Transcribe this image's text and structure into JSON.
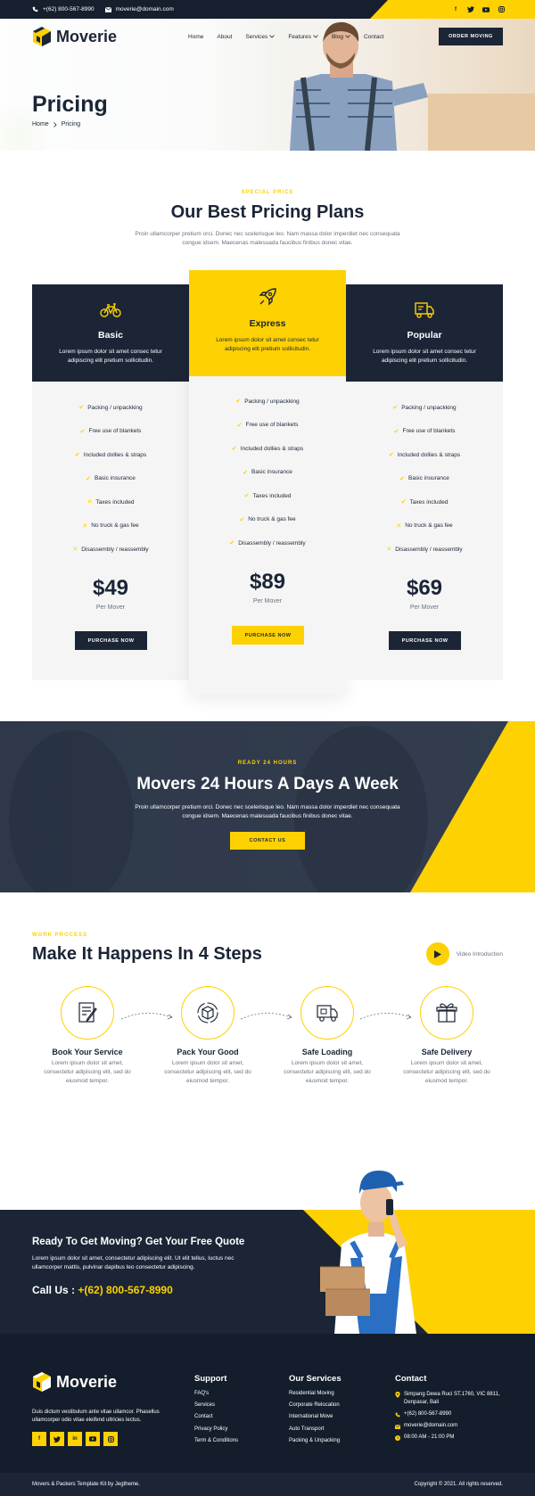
{
  "topbar": {
    "phone": "+(62) 800-567-8990",
    "email": "moverie@domain.com",
    "socials": [
      "facebook-icon",
      "twitter-icon",
      "youtube-icon",
      "instagram-icon"
    ]
  },
  "nav": {
    "brand": "Moverie",
    "items": [
      {
        "label": "Home",
        "dropdown": false
      },
      {
        "label": "About",
        "dropdown": false
      },
      {
        "label": "Services",
        "dropdown": true
      },
      {
        "label": "Features",
        "dropdown": true
      },
      {
        "label": "Blog",
        "dropdown": true
      },
      {
        "label": "Contact",
        "dropdown": false
      }
    ],
    "cta": "ORDER MOVING"
  },
  "hero": {
    "title": "Pricing",
    "breadcrumb": [
      "Home",
      "Pricing"
    ]
  },
  "pricing": {
    "eyebrow": "SPECIAL PRICE",
    "title": "Our Best Pricing Plans",
    "desc": "Proin ullamcorper pretium orci. Donec nec scelerisque leo. Nam massa dolor imperdiet nec consequata congue idsem. Maecenas malesuada faucibus finibus donec vitae.",
    "plans": [
      {
        "name": "Basic",
        "icon": "bicycle-icon",
        "desc": "Lorem ipsum dolor sit amet consec tetur adipiscing elit pretium sollicitudin.",
        "features": [
          {
            "label": "Packing / unpackking",
            "included": true
          },
          {
            "label": "Free use of blankets",
            "included": true
          },
          {
            "label": "Included dollies & straps",
            "included": true
          },
          {
            "label": "Basic insurance",
            "included": true
          },
          {
            "label": "Taxes included",
            "included": false
          },
          {
            "label": "No truck & gas fee",
            "included": false
          },
          {
            "label": "Disassembly / reassembly",
            "included": false
          }
        ],
        "price": "$49",
        "per": "Per Mover",
        "button": "PURCHASE NOW"
      },
      {
        "name": "Express",
        "icon": "rocket-icon",
        "desc": "Lorem ipsum dolor sit amet consec tetur adipiscing elit pretium sollicitudin.",
        "features": [
          {
            "label": "Packing / unpackking",
            "included": true
          },
          {
            "label": "Free use of blankets",
            "included": true
          },
          {
            "label": "Included dollies & straps",
            "included": true
          },
          {
            "label": "Basic insurance",
            "included": true
          },
          {
            "label": "Taxes included",
            "included": true
          },
          {
            "label": "No truck & gas fee",
            "included": true
          },
          {
            "label": "Disassembly / reassembly",
            "included": true
          }
        ],
        "price": "$89",
        "per": "Per Mover",
        "button": "PURCHASE NOW"
      },
      {
        "name": "Popular",
        "icon": "truck-icon",
        "desc": "Lorem ipsum dolor sit amet consec tetur adipiscing elit pretium sollicitudin.",
        "features": [
          {
            "label": "Packing / unpackking",
            "included": true
          },
          {
            "label": "Free use of blankets",
            "included": true
          },
          {
            "label": "Included dollies & straps",
            "included": true
          },
          {
            "label": "Basic insurance",
            "included": true
          },
          {
            "label": "Taxes included",
            "included": true
          },
          {
            "label": "No truck & gas fee",
            "included": false
          },
          {
            "label": "Disassembly / reassembly",
            "included": false
          }
        ],
        "price": "$69",
        "per": "Per Mover",
        "button": "PURCHASE NOW"
      }
    ]
  },
  "banner": {
    "eyebrow": "READY 24 HOURS",
    "title": "Movers 24 Hours A Days A Week",
    "desc": "Proin ullamcorper pretium orci. Donec nec scelerisque leo. Nam massa dolor imperdiet nec consequata congue idsem. Maecenas malesuada faucibus finibus donec vitae.",
    "button": "CONTACT US"
  },
  "process": {
    "eyebrow": "WORK PROCESS",
    "title": "Make It Happens In 4 Steps",
    "video": "Video Introduction",
    "steps": [
      {
        "title": "Book Your Service",
        "icon": "document-icon",
        "desc": "Lorem ipsum dolor sit amet, consectetur adipiscing elit, sed do eiusmod tempor."
      },
      {
        "title": "Pack Your Good",
        "icon": "box-icon",
        "desc": "Lorem ipsum dolor sit amet, consectetur adipiscing elit, sed do eiusmod tempor."
      },
      {
        "title": "Safe Loading",
        "icon": "truck-icon",
        "desc": "Lorem ipsum dolor sit amet, consectetur adipiscing elit, sed do eiusmod tempor."
      },
      {
        "title": "Safe Delivery",
        "icon": "gift-icon",
        "desc": "Lorem ipsum dolor sit amet, consectetur adipiscing elit, sed do eiusmod tempor."
      }
    ]
  },
  "quote": {
    "title": "Ready To Get Moving? Get Your Free Quote",
    "desc": "Lorem ipsum dolor sit amet, consectetur adipiscing elit. Ut elit tellus, luctus nec ullamcorper mattis, pulvinar dapibus leo consectetur adipiscing.",
    "call_label": "Call Us : ",
    "call_number": "+(62) 800-567-8990"
  },
  "footer": {
    "brand": "Moverie",
    "desc": "Duis dictum vestibulum ante vitae ullamcor. Phasellus ullamcorper odio vitae eleifend ultricies lectus.",
    "socials": [
      "facebook-icon",
      "twitter-icon",
      "linkedin-icon",
      "youtube-icon",
      "instagram-icon"
    ],
    "support": {
      "title": "Support",
      "links": [
        "FAQ's",
        "Services",
        "Contact",
        "Privacy Policy",
        "Term & Conditions"
      ]
    },
    "services": {
      "title": "Our Services",
      "links": [
        "Residential Moving",
        "Corporate Relocation",
        "International Move",
        "Auto Transport",
        "Packing & Unpacking"
      ]
    },
    "contact": {
      "title": "Contact",
      "items": [
        {
          "icon": "location-icon",
          "text": "Simpang Dewa Ruci ST.1760, VIC 8811, Denpasar, Bali"
        },
        {
          "icon": "phone-icon",
          "text": "+(62) 800-567-8990"
        },
        {
          "icon": "mail-icon",
          "text": "moverie@domain.com"
        },
        {
          "icon": "clock-icon",
          "text": "08:00 AM - 21:00 PM"
        }
      ]
    },
    "credit": "Movers & Packers Template Kit by Jegtheme.",
    "copyright": "Copyright © 2021. All rights reserved."
  },
  "colors": {
    "accent": "#fed103",
    "dark": "#1b2536",
    "footer": "#141d2b"
  }
}
